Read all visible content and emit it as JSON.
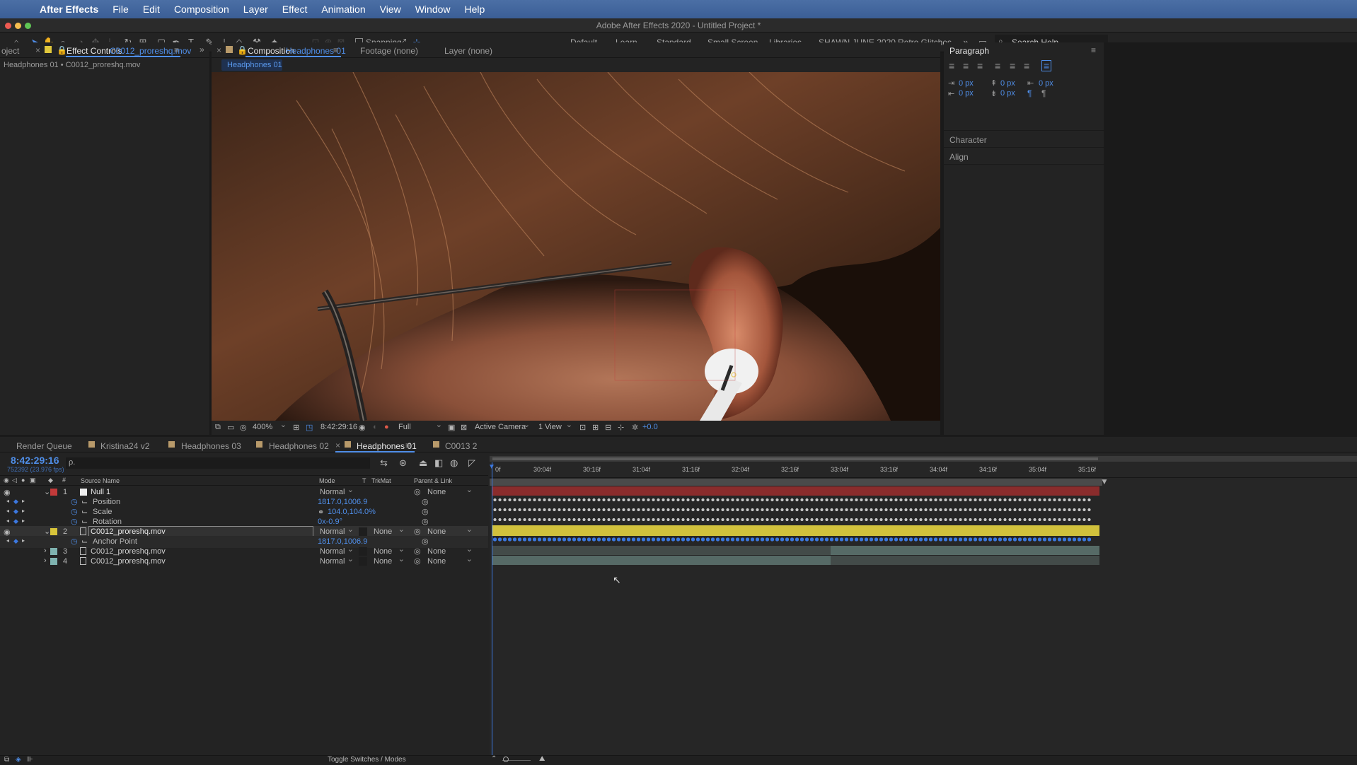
{
  "menubar": {
    "app": "After Effects",
    "items": [
      "File",
      "Edit",
      "Composition",
      "Layer",
      "Effect",
      "Animation",
      "View",
      "Window",
      "Help"
    ]
  },
  "titlebar": {
    "title": "Adobe After Effects 2020 - Untitled Project *"
  },
  "toolbar": {
    "snapping_label": "Snapping",
    "workspaces": [
      "Default",
      "Learn",
      "Standard",
      "Small Screen",
      "Libraries",
      "SHAWN JUNE 2020",
      "Retro Glitches"
    ],
    "search_placeholder": "Search Help"
  },
  "left_panel": {
    "tab_project": "oject",
    "tab_effect_controls": "Effect Controls",
    "tab_effect_target": "C0012_proreshq.mov",
    "breadcrumb": "Headphones 01 • C0012_proreshq.mov"
  },
  "viewer": {
    "tab_comp_label": "Composition",
    "tab_comp_name": "Headphones 01",
    "tab_footage": "Footage (none)",
    "tab_layer": "Layer (none)",
    "sub_tab": "Headphones 01",
    "zoom": "400%",
    "timecode": "8:42:29:16",
    "resolution": "Full",
    "camera": "Active Camera",
    "views": "1 View",
    "exposure": "+0.0"
  },
  "paragraph": {
    "title": "Paragraph",
    "indent_values": [
      "0 px",
      "0 px",
      "0 px",
      "0 px",
      "0 px"
    ],
    "character": "Character",
    "align": "Align"
  },
  "timeline": {
    "tabs": [
      "Render Queue",
      "Kristina24 v2",
      "Headphones 03",
      "Headphones 02",
      "Headphones 01",
      "C0013 2"
    ],
    "current_time": "8:42:29:16",
    "frame_info": "752392 (23.976 fps)",
    "search_placeholder": "ρ.",
    "col_source": "Source Name",
    "col_mode": "Mode",
    "col_t": "T",
    "col_trkmat": "TrkMat",
    "col_parent": "Parent & Link",
    "ruler": [
      "0f",
      "30:04f",
      "30:16f",
      "31:04f",
      "31:16f",
      "32:04f",
      "32:16f",
      "33:04f",
      "33:16f",
      "34:04f",
      "34:16f",
      "35:04f",
      "35:16f"
    ],
    "layers": [
      {
        "num": "1",
        "name": "Null 1",
        "mode": "Normal",
        "trkmat": "",
        "parent": "None",
        "color": "#c23a3a"
      },
      {
        "num": "2",
        "name": "C0012_proreshq.mov",
        "mode": "Normal",
        "trkmat": "None",
        "parent": "None",
        "color": "#d8c43a"
      },
      {
        "num": "3",
        "name": "C0012_proreshq.mov",
        "mode": "Normal",
        "trkmat": "None",
        "parent": "None",
        "color": "#7fb3b0"
      },
      {
        "num": "4",
        "name": "C0012_proreshq.mov",
        "mode": "Normal",
        "trkmat": "None",
        "parent": "None",
        "color": "#7fb3b0"
      }
    ],
    "props": {
      "position": {
        "label": "Position",
        "value": "1817.0,1006.9"
      },
      "scale": {
        "label": "Scale",
        "value": "104.0,104.0%"
      },
      "rotation": {
        "label": "Rotation",
        "value": "0x-0.9°"
      },
      "anchor": {
        "label": "Anchor Point",
        "value": "1817.0,1006.9"
      }
    },
    "toggle_label": "Toggle Switches / Modes"
  },
  "colors": {
    "accent": "#4f8ee8",
    "null_bar": "#8a2c2c",
    "yellow_bar": "#d1c13c",
    "teal_bar": "#566a66"
  }
}
